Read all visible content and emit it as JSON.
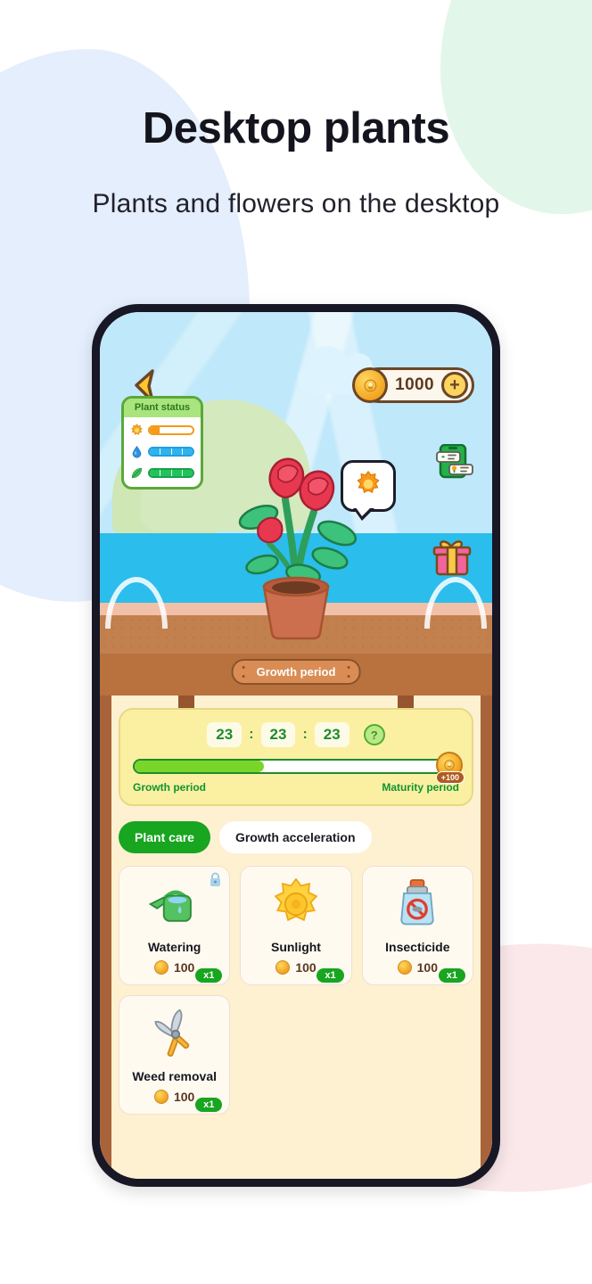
{
  "header": {
    "title": "Desktop plants",
    "subtitle": "Plants and flowers on the desktop"
  },
  "colors": {
    "accent_green": "#18a520",
    "coin_gold": "#f0a020",
    "sky": "#bfe8fa",
    "water": "#2bbdeb",
    "shelf_wood": "#c2804f",
    "panel_bg": "#fdf1d2",
    "timer_card": "#fbf0a2",
    "frame": "#171726"
  },
  "game": {
    "back_icon": "back-chevron-icon",
    "currency": {
      "icon": "coin-icon",
      "amount": "1000",
      "add_label": "+"
    },
    "status_panel": {
      "title": "Plant status",
      "bars": [
        {
          "icon": "sun-icon",
          "segments": 4,
          "filled": 1,
          "color": "#f59a1a"
        },
        {
          "icon": "water-drop-icon",
          "segments": 4,
          "filled": 4,
          "color": "#2fb3ec"
        },
        {
          "icon": "leaf-icon",
          "segments": 4,
          "filled": 4,
          "color": "#21c35b"
        }
      ]
    },
    "bubble": {
      "icon": "sun-need-icon"
    },
    "side_icons": [
      {
        "name": "tasks-icon"
      },
      {
        "name": "gift-icon"
      }
    ],
    "plant": {
      "name": "rose-plant",
      "pot": "terracotta-pot"
    },
    "plaque_label": "Growth period"
  },
  "timer": {
    "hours": "23",
    "minutes": "23",
    "seconds": "23",
    "separator": ":",
    "help_label": "?",
    "progress_percent": 40,
    "reward_badge": "+100",
    "left_label": "Growth period",
    "right_label": "Maturity period"
  },
  "tabs": [
    {
      "label": "Plant care",
      "active": true
    },
    {
      "label": "Growth acceleration",
      "active": false
    }
  ],
  "items": [
    {
      "name": "Watering",
      "icon": "watering-can-icon",
      "qty": "x1",
      "price": "100",
      "locked": true
    },
    {
      "name": "Sunlight",
      "icon": "sun-icon",
      "qty": "x1",
      "price": "100",
      "locked": false
    },
    {
      "name": "Insecticide",
      "icon": "insecticide-icon",
      "qty": "x1",
      "price": "100",
      "locked": false
    },
    {
      "name": "Weed removal",
      "icon": "shears-icon",
      "qty": "x1",
      "price": "100",
      "locked": false
    }
  ]
}
